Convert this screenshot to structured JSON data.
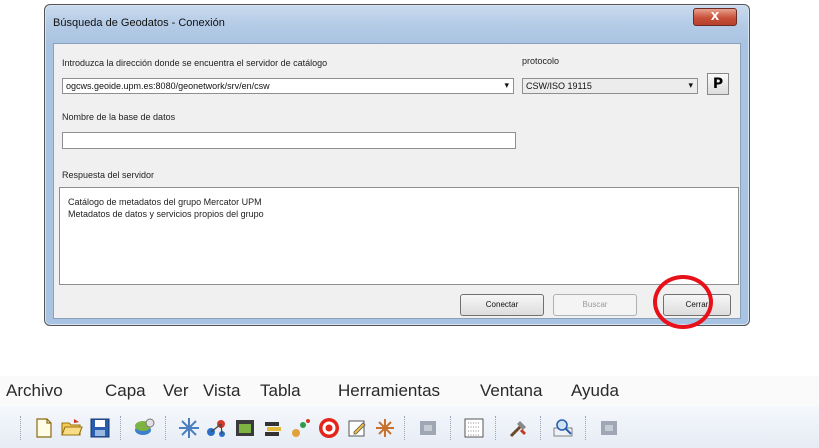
{
  "dialog": {
    "title": "Búsqueda de Geodatos - Conexión",
    "close_label": "X",
    "address_label": "Introduzca la dirección donde se encuentra el servidor de catálogo",
    "address_value": "ogcws.geoide.upm.es:8080/geonetwork/srv/en/csw",
    "protocols_label": "protocolo",
    "protocol_value": "CSW/ISO 19115",
    "p_button": "P",
    "database_label": "Nombre de la base de datos",
    "database_value": "",
    "response_label": "Respuesta del servidor",
    "response_lines": [
      "Catálogo de metadatos del grupo Mercator UPM",
      "Metadatos de datos y servicios propios del grupo"
    ],
    "buttons": {
      "connect": "Conectar",
      "search": "Buscar",
      "close": "Cerrar"
    }
  },
  "menubar": {
    "items": [
      "Archivo",
      "Capa",
      "Ver",
      "Vista",
      "Tabla",
      "Herramientas",
      "Ventana",
      "Ayuda"
    ]
  },
  "toolbar": {
    "icons": [
      "new-document-icon",
      "open-folder-icon",
      "save-disk-icon",
      "add-layer-icon",
      "flower-tool-icon",
      "network-icon",
      "window-icon",
      "stack-icon",
      "chart-icon",
      "target-icon",
      "edit-icon",
      "flower2-icon",
      "gray-icon-1",
      "grid-icon",
      "tools-icon",
      "search-icon",
      "gray-icon-2"
    ]
  },
  "colors": {
    "highlight": "#e8111a",
    "titlebar": "#b4cbe6",
    "close_button": "#c9513a"
  }
}
